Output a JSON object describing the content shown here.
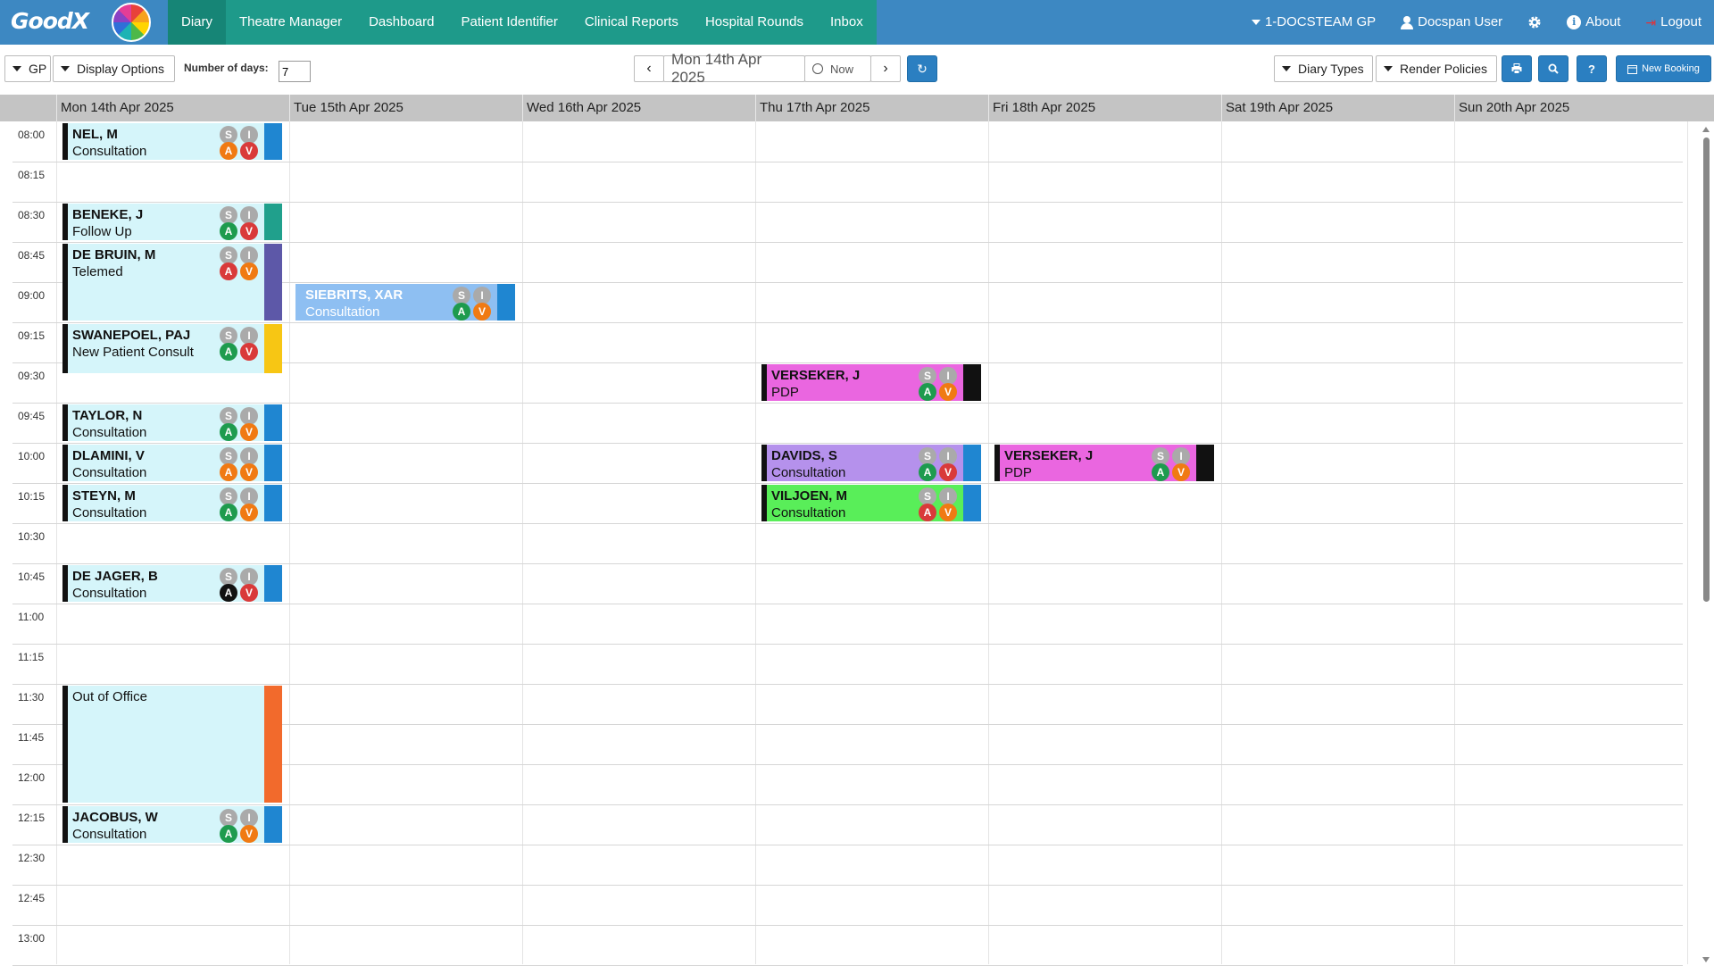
{
  "logo": {
    "text": "GoodX"
  },
  "nav": {
    "items": [
      "Diary",
      "Theatre Manager",
      "Dashboard",
      "Patient Identifier",
      "Clinical Reports",
      "Hospital Rounds",
      "Inbox"
    ]
  },
  "nav_right": {
    "practice": "1-DOCSTEAM GP",
    "user": "Docspan User",
    "about": "About",
    "logout": "Logout"
  },
  "toolbar": {
    "diary_select": "GP",
    "display_options": "Display Options",
    "days_label": "Number of days:",
    "days_value": "7",
    "current_date": "Mon 14th Apr 2025",
    "now_label": "Now",
    "diary_types": "Diary Types",
    "render_policies": "Render Policies",
    "help_label": "?",
    "new_booking": "New Booking"
  },
  "days": [
    "Mon 14th Apr 2025",
    "Tue 15th Apr 2025",
    "Wed 16th Apr 2025",
    "Thu 17th Apr 2025",
    "Fri 18th Apr 2025",
    "Sat 19th Apr 2025",
    "Sun 20th Apr 2025"
  ],
  "times": [
    "08:00",
    "08:15",
    "08:30",
    "08:45",
    "09:00",
    "09:15",
    "09:30",
    "09:45",
    "10:00",
    "10:15",
    "10:30",
    "10:45",
    "11:00",
    "11:15",
    "11:30",
    "11:45",
    "12:00",
    "12:15",
    "12:30",
    "12:45",
    "13:00"
  ],
  "colors": {
    "nav_blue": "#3d88c2",
    "nav_teal": "#1e9a8a",
    "header_grey": "#c4c4c4"
  },
  "appointments": [
    {
      "day": 0,
      "start": "08:00",
      "slots": 1,
      "name": "NEL, M",
      "type": "Consultation",
      "bg": "#d5f5fa",
      "stripe": "#1f86d1",
      "badges": [
        "o",
        "r"
      ]
    },
    {
      "day": 0,
      "start": "08:30",
      "slots": 1,
      "name": "BENEKE, J",
      "type": "Follow Up",
      "bg": "#d5f5fa",
      "stripe": "#20a08c",
      "badges": [
        "g",
        "r"
      ]
    },
    {
      "day": 0,
      "start": "08:45",
      "slots": 2,
      "name": "DE BRUIN, M",
      "type": "Telemed",
      "bg": "#d5f5fa",
      "stripe": "#5d58a8",
      "badges": [
        "r",
        "o"
      ]
    },
    {
      "day": 0,
      "start": "09:15",
      "slots": 1.3,
      "name": "SWANEPOEL, PAJ",
      "type": "New Patient Consult",
      "bg": "#d5f5fa",
      "stripe": "#f7c614",
      "badges": [
        "g",
        "r"
      ]
    },
    {
      "day": 0,
      "start": "09:45",
      "slots": 1,
      "name": "TAYLOR, N",
      "type": "Consultation",
      "bg": "#d5f5fa",
      "stripe": "#1f86d1",
      "badges": [
        "g",
        "o"
      ]
    },
    {
      "day": 0,
      "start": "10:00",
      "slots": 1,
      "name": "DLAMINI, V",
      "type": "Consultation",
      "bg": "#d5f5fa",
      "stripe": "#1f86d1",
      "badges": [
        "o",
        "o"
      ]
    },
    {
      "day": 0,
      "start": "10:15",
      "slots": 1,
      "name": "STEYN, M",
      "type": "Consultation",
      "bg": "#d5f5fa",
      "stripe": "#1f86d1",
      "badges": [
        "g",
        "o"
      ]
    },
    {
      "day": 0,
      "start": "10:45",
      "slots": 1,
      "name": "DE JAGER, B",
      "type": "Consultation",
      "bg": "#d5f5fa",
      "stripe": "#1f86d1",
      "badges": [
        "k",
        "r"
      ]
    },
    {
      "day": 0,
      "start": "11:30",
      "slots": 3,
      "name": "",
      "type": "Out of Office",
      "bg": "#d5f5fa",
      "stripe": "#f26a2c",
      "badges": []
    },
    {
      "day": 0,
      "start": "12:15",
      "slots": 1,
      "name": "JACOBUS, W",
      "type": "Consultation",
      "bg": "#d5f5fa",
      "stripe": "#1f86d1",
      "badges": [
        "g",
        "o"
      ]
    },
    {
      "day": 1,
      "start": "09:00",
      "slots": 1,
      "name": "SIEBRITS, XAR",
      "type": "Consultation",
      "bg": "#8ebff2",
      "stripe": "#1f86d1",
      "badges": [
        "g",
        "o"
      ],
      "text": "#fff",
      "noborder": true
    },
    {
      "day": 3,
      "start": "09:30",
      "slots": 1,
      "name": "VERSEKER, J",
      "type": "PDP",
      "bg": "#ea66e0",
      "stripe": "#111111",
      "badges": [
        "g",
        "o"
      ]
    },
    {
      "day": 3,
      "start": "10:00",
      "slots": 1,
      "name": "DAVIDS, S",
      "type": "Consultation",
      "bg": "#b591ec",
      "stripe": "#1f86d1",
      "badges": [
        "g",
        "r"
      ]
    },
    {
      "day": 3,
      "start": "10:15",
      "slots": 1,
      "name": "VILJOEN, M",
      "type": "Consultation",
      "bg": "#59ee59",
      "stripe": "#1f86d1",
      "badges": [
        "r",
        "o"
      ]
    },
    {
      "day": 4,
      "start": "10:00",
      "slots": 1,
      "name": "VERSEKER, J",
      "type": "PDP",
      "bg": "#ea66e0",
      "stripe": "#111111",
      "badges": [
        "g",
        "o"
      ]
    }
  ]
}
